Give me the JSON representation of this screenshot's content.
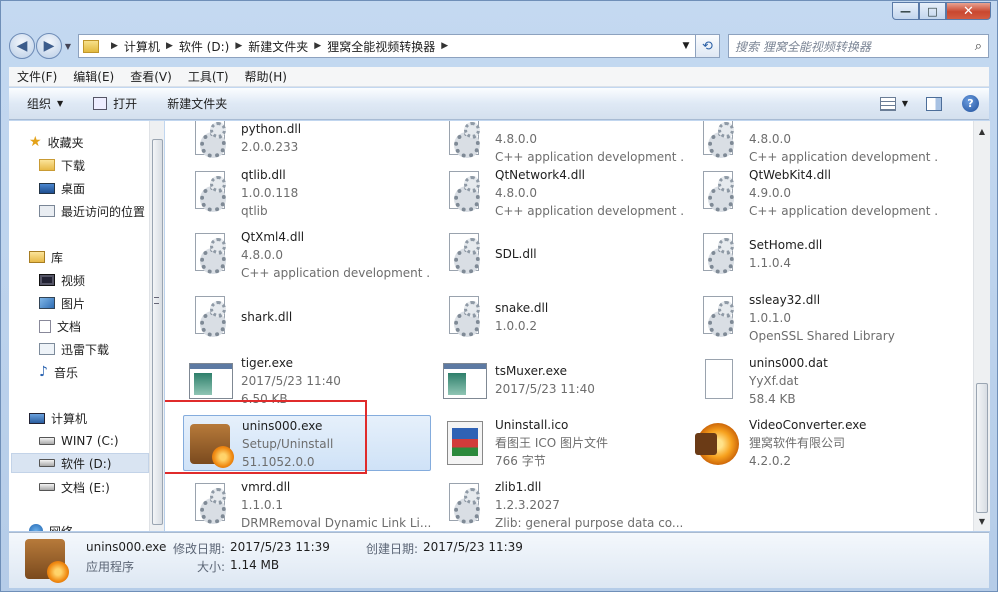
{
  "window": {
    "controls": {
      "minimize": "—",
      "maximize": "□",
      "close": "✕"
    }
  },
  "nav": {
    "back_icon": "back-arrow-icon",
    "forward_icon": "forward-arrow-icon",
    "breadcrumbs": [
      "计算机",
      "软件 (D:)",
      "新建文件夹",
      "狸窝全能视频转换器"
    ],
    "search_placeholder": "搜索 狸窝全能视频转换器"
  },
  "menu": [
    "文件(F)",
    "编辑(E)",
    "查看(V)",
    "工具(T)",
    "帮助(H)"
  ],
  "toolbar": {
    "organize": "组织",
    "open": "打开",
    "new_folder": "新建文件夹"
  },
  "sidebar": {
    "favorites": {
      "label": "收藏夹",
      "items": [
        "下载",
        "桌面",
        "最近访问的位置"
      ]
    },
    "libraries": {
      "label": "库",
      "items": [
        "视频",
        "图片",
        "文档",
        "迅雷下载",
        "音乐"
      ]
    },
    "computer": {
      "label": "计算机",
      "items": [
        "WIN7 (C:)",
        "软件 (D:)",
        "文档 (E:)"
      ]
    },
    "network": {
      "label": "网络"
    }
  },
  "files": [
    {
      "name": "python.dll",
      "l2": "2.0.0.233",
      "l3": "",
      "icon": "dll"
    },
    {
      "name": "",
      "l2": "4.8.0.0",
      "l3": "C++ application development ...",
      "icon": "dll"
    },
    {
      "name": "",
      "l2": "4.8.0.0",
      "l3": "C++ application development ...",
      "icon": "dll"
    },
    {
      "name": "qtlib.dll",
      "l2": "1.0.0.118",
      "l3": "qtlib",
      "icon": "dll"
    },
    {
      "name": "QtNetwork4.dll",
      "l2": "4.8.0.0",
      "l3": "C++ application development ...",
      "icon": "dll"
    },
    {
      "name": "QtWebKit4.dll",
      "l2": "4.9.0.0",
      "l3": "C++ application development ...",
      "icon": "dll"
    },
    {
      "name": "QtXml4.dll",
      "l2": "4.8.0.0",
      "l3": "C++ application development ...",
      "icon": "dll"
    },
    {
      "name": "SDL.dll",
      "l2": "",
      "l3": "",
      "icon": "dll"
    },
    {
      "name": "SetHome.dll",
      "l2": "1.1.0.4",
      "l3": "",
      "icon": "dll"
    },
    {
      "name": "shark.dll",
      "l2": "",
      "l3": "",
      "icon": "dll"
    },
    {
      "name": "snake.dll",
      "l2": "1.0.0.2",
      "l3": "",
      "icon": "dll"
    },
    {
      "name": "ssleay32.dll",
      "l2": "1.0.1.0",
      "l3": "OpenSSL Shared Library",
      "icon": "dll"
    },
    {
      "name": "tiger.exe",
      "l2": "2017/5/23 11:40",
      "l3": "6.50 KB",
      "icon": "exe"
    },
    {
      "name": "tsMuxer.exe",
      "l2": "2017/5/23 11:40",
      "l3": "",
      "icon": "exe"
    },
    {
      "name": "unins000.dat",
      "l2": "YyXf.dat",
      "l3": "58.4 KB",
      "icon": "dat"
    },
    {
      "name": "unins000.exe",
      "l2": "Setup/Uninstall",
      "l3": "51.1052.0.0",
      "icon": "box"
    },
    {
      "name": "Uninstall.ico",
      "l2": "看图王 ICO 图片文件",
      "l3": "766 字节",
      "icon": "ico"
    },
    {
      "name": "VideoConverter.exe",
      "l2": "狸窝软件有限公司",
      "l3": "4.2.0.2",
      "icon": "vc"
    },
    {
      "name": "vmrd.dll",
      "l2": "1.1.0.1",
      "l3": "DRMRemoval Dynamic Link Li...",
      "icon": "dll"
    },
    {
      "name": "zlib1.dll",
      "l2": "1.2.3.2027",
      "l3": "Zlib: general purpose data co...",
      "icon": "dll"
    }
  ],
  "details": {
    "name": "unins000.exe",
    "modified_label": "修改日期:",
    "modified": "2017/5/23 11:39",
    "created_label": "创建日期:",
    "created": "2017/5/23 11:39",
    "type": "应用程序",
    "size_label": "大小:",
    "size": "1.14 MB"
  }
}
